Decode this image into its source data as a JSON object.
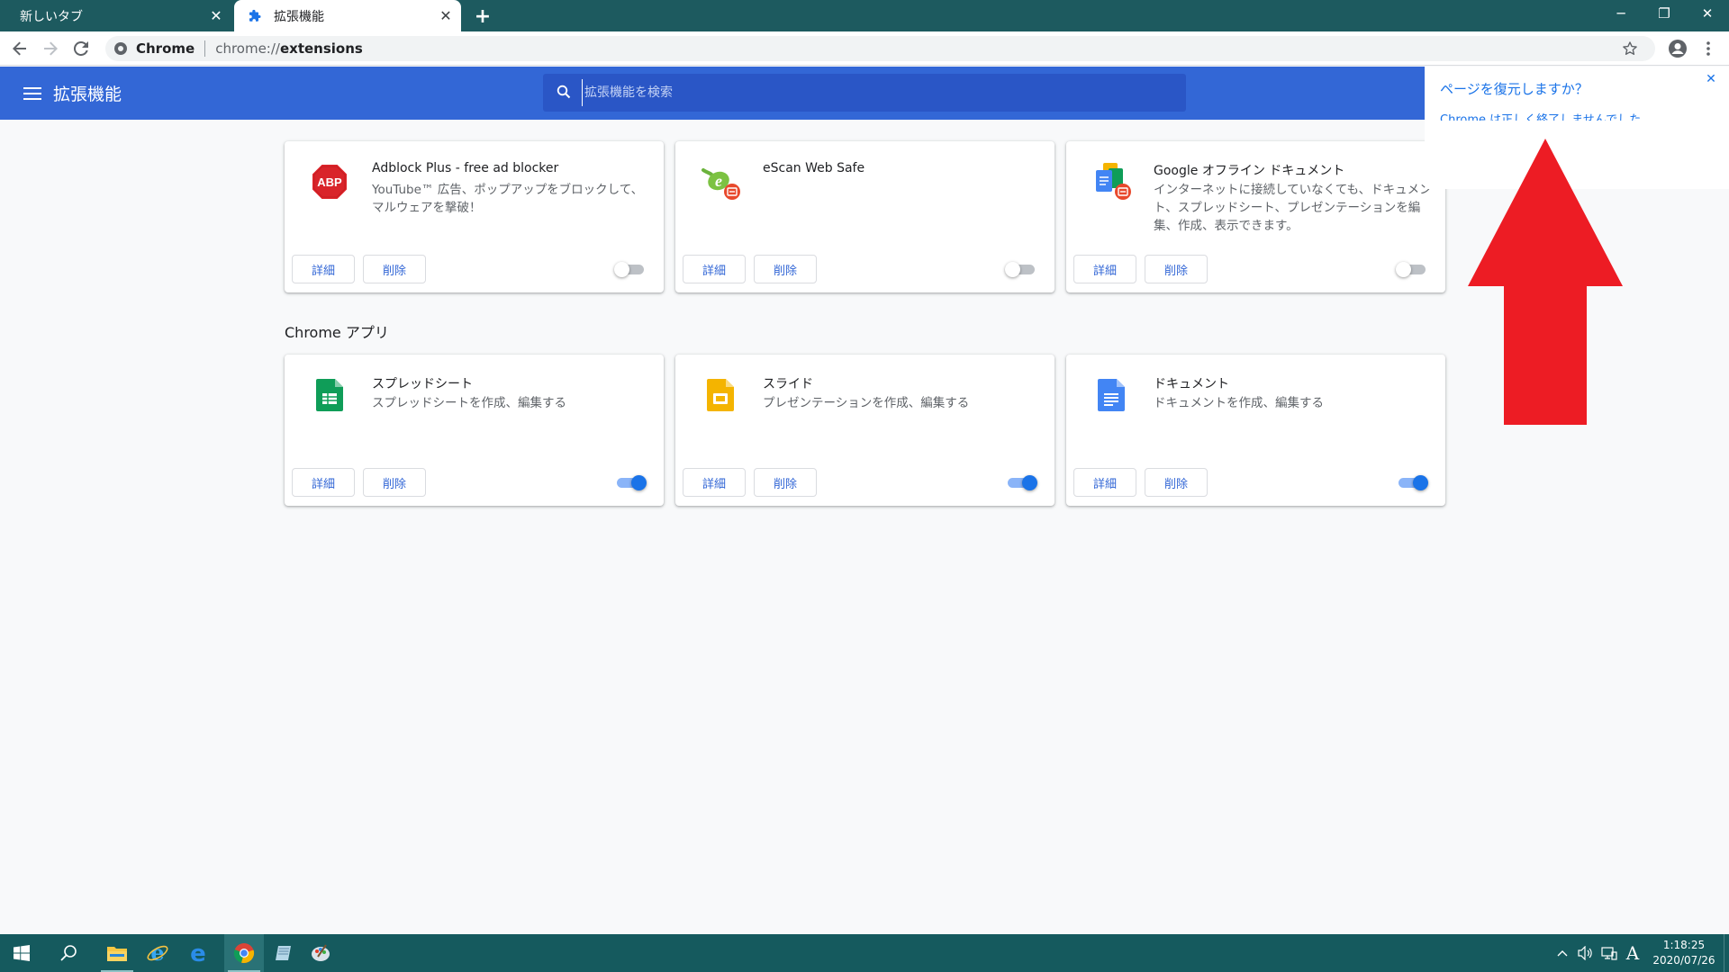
{
  "browser": {
    "tabs": [
      {
        "title": "新しいタブ",
        "close": "✕",
        "active": false
      },
      {
        "title": "拡張機能",
        "close": "✕",
        "active": true
      }
    ],
    "new_tab": "+",
    "window_controls": {
      "minimize": "─",
      "restore": "❐",
      "close": "✕"
    },
    "omnibox": {
      "chip": "Chrome",
      "scheme": "chrome://",
      "host": "extensions"
    }
  },
  "header": {
    "title": "拡張機能",
    "search_placeholder": "拡張機能を検索"
  },
  "extensions": [
    {
      "name": "Adblock Plus - free ad blocker",
      "desc": "YouTube™ 広告、ポップアップをブロックして、マルウェアを撃破！",
      "details": "詳細",
      "remove": "削除",
      "enabled": false,
      "icon": "abp-icon"
    },
    {
      "name": "eScan Web Safe",
      "desc": "",
      "details": "詳細",
      "remove": "削除",
      "enabled": false,
      "icon": "escan-icon"
    },
    {
      "name": "Google オフライン ドキュメント",
      "desc": "インターネットに接続していなくても、ドキュメント、スプレッドシート、プレゼンテーションを編集、作成、表示できます。",
      "details": "詳細",
      "remove": "削除",
      "enabled": false,
      "icon": "google-docs-offline-icon"
    }
  ],
  "apps_section_title": "Chrome アプリ",
  "apps": [
    {
      "name": "スプレッドシート",
      "desc": "スプレッドシートを作成、編集する",
      "details": "詳細",
      "remove": "削除",
      "enabled": true,
      "icon": "sheets-icon"
    },
    {
      "name": "スライド",
      "desc": "プレゼンテーションを作成、編集する",
      "details": "詳細",
      "remove": "削除",
      "enabled": true,
      "icon": "slides-icon"
    },
    {
      "name": "ドキュメント",
      "desc": "ドキュメントを作成、編集する",
      "details": "詳細",
      "remove": "削除",
      "enabled": true,
      "icon": "docs-icon"
    }
  ],
  "restore_popup": {
    "title": "ページを復元しますか？",
    "text": "Chrome は正しく終了しませんでした",
    "close": "✕"
  },
  "annotation": {
    "arrow_color": "#ed1c24"
  },
  "taskbar": {
    "time": "1:18:25",
    "date": "2020/07/26",
    "ime": "A",
    "tray_chevron": "^"
  },
  "colors": {
    "accent": "#3367d6",
    "toggle_on": "#1a73e8",
    "taskbar": "#155a5e"
  }
}
